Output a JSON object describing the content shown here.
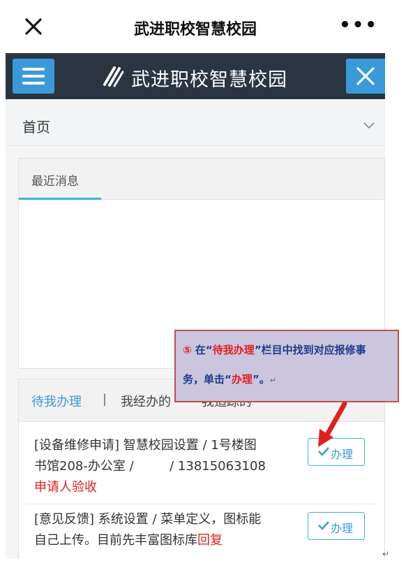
{
  "topbar": {
    "title": "武进职校智慧校园",
    "more": "•••"
  },
  "app_header": {
    "title": "武进职校智慧校园"
  },
  "breadcrumb": {
    "home": "首页"
  },
  "recent_panel": {
    "title": "最近消息"
  },
  "pending_panel": {
    "tabs": {
      "active": "待我办理",
      "separator": "|",
      "second": "我经办的",
      "third": "我追踪的"
    },
    "items": [
      {
        "line1": "[设备维修申请]  智慧校园设置 / 1号楼图",
        "line2": "书馆208-办公室 /         / 13815063108",
        "status": "申请人验收",
        "button": "办理"
      },
      {
        "line1": "[意见反馈]  系统设置 / 菜单定义，图标能",
        "line2": "自己上传。目前先丰富图标库",
        "status": "回复",
        "button": "办理"
      }
    ]
  },
  "annotation": {
    "num": "⑤",
    "pre": " 在“",
    "hl1": "待我办理",
    "mid": "”栏目中找到对应报修事",
    "pre2": "务，单击“",
    "hl2": "办理",
    "post": "”。",
    "return_mark": "↵"
  },
  "colors": {
    "accent": "#3a9ad9",
    "header_bg": "#2b3542",
    "status_red": "#e02020",
    "callout_bg": "#cbc5dd",
    "callout_border": "#c0504d"
  }
}
